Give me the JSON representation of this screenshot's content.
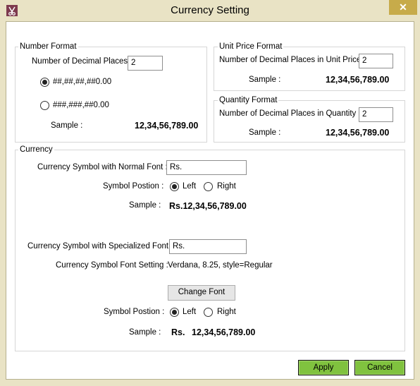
{
  "window": {
    "title": "Currency Setting",
    "close_glyph": "✕",
    "icon": "app-scissors-icon"
  },
  "number_format": {
    "legend": "Number Format",
    "decimal_label": "Number of Decimal Places :",
    "decimal_value": "2",
    "option1": "##,##,##,##0.00",
    "option2": "###,###,##0.00",
    "selected": "option1",
    "sample_label": "Sample :",
    "sample_value": "12,34,56,789.00"
  },
  "unit_price_format": {
    "legend": "Unit Price Format",
    "decimal_label": "Number of Decimal Places in Unit Price :",
    "decimal_value": "2",
    "sample_label": "Sample :",
    "sample_value": "12,34,56,789.00"
  },
  "quantity_format": {
    "legend": "Quantity Format",
    "decimal_label": "Number of Decimal Places in Quantity :",
    "decimal_value": "2",
    "sample_label": "Sample :",
    "sample_value": "12,34,56,789.00"
  },
  "currency": {
    "legend": "Currency",
    "normal_symbol_label": "Currency Symbol  with Normal Font :",
    "normal_symbol_value": "Rs.",
    "position_label": "Symbol Postion :",
    "left_label": "Left",
    "right_label": "Right",
    "normal_position": "left",
    "normal_sample_label": "Sample :",
    "normal_sample_value": "Rs.12,34,56,789.00",
    "special_symbol_label": "Currency Symbol with Specialized Font:",
    "special_symbol_value": "Rs.",
    "font_setting_label": "Currency Symbol Font Setting :",
    "font_setting_value": "Verdana, 8.25, style=Regular",
    "change_font_label": "Change Font",
    "special_position_label": "Symbol Postion :",
    "special_position": "left",
    "special_sample_label": "Sample :",
    "special_sample_symbol": "Rs.",
    "special_sample_value": "12,34,56,789.00"
  },
  "footer": {
    "apply_label": "Apply",
    "cancel_label": "Cancel",
    "button_color": "#80c23f"
  }
}
